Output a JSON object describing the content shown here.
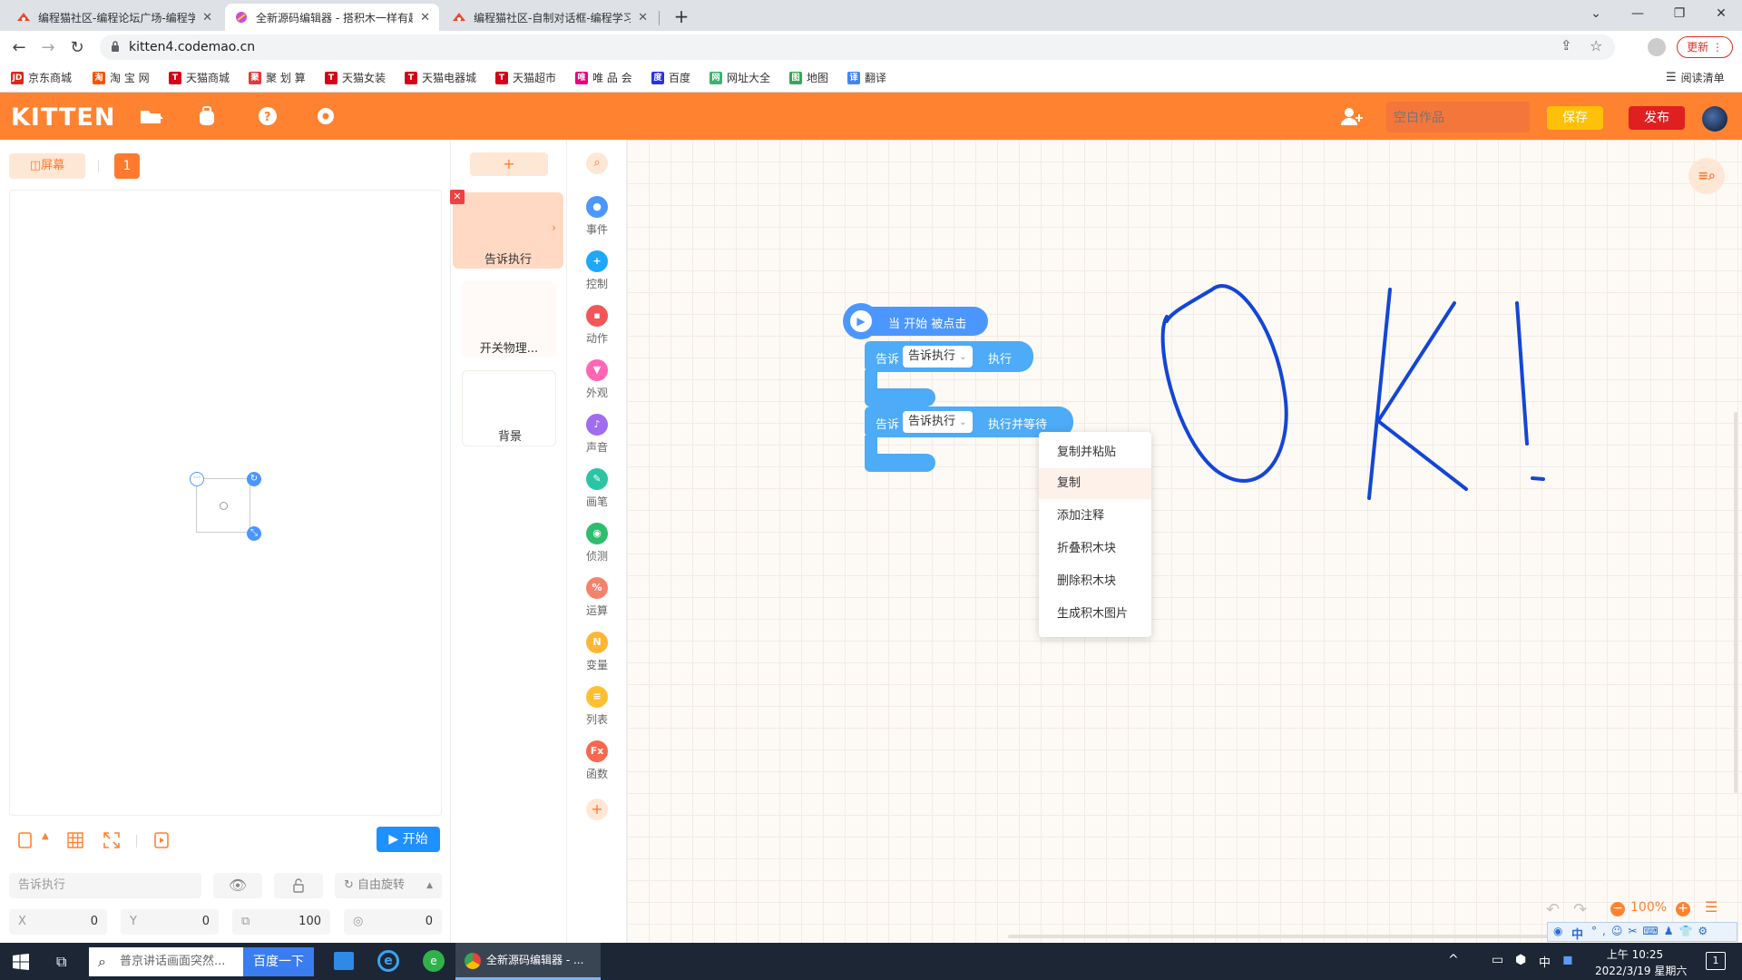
{
  "browser": {
    "tabs": [
      {
        "title": "编程猫社区-编程论坛广场-编程学"
      },
      {
        "title": "全新源码编辑器 - 搭积木一样有趣"
      },
      {
        "title": "编程猫社区-自制对话框-编程学习"
      }
    ],
    "new_tab": "+",
    "url": "kitten4.codemao.cn",
    "update_label": "更新",
    "bookmarks": [
      {
        "label": "京东商城",
        "badge": "JD",
        "color": "#e1251b"
      },
      {
        "label": "淘 宝 网",
        "badge": "淘",
        "color": "#ff5000"
      },
      {
        "label": "天猫商城",
        "badge": "T",
        "color": "#d4001a"
      },
      {
        "label": "聚 划 算",
        "badge": "聚",
        "color": "#e4393c"
      },
      {
        "label": "天猫女装",
        "badge": "T",
        "color": "#d4001a"
      },
      {
        "label": "天猫电器城",
        "badge": "T",
        "color": "#d4001a"
      },
      {
        "label": "天猫超市",
        "badge": "T",
        "color": "#d4001a"
      },
      {
        "label": "唯 品 会",
        "badge": "唯",
        "color": "#e6007e"
      },
      {
        "label": "百度",
        "badge": "度",
        "color": "#2932e1"
      },
      {
        "label": "网址大全",
        "badge": "网",
        "color": "#3cb371"
      },
      {
        "label": "地图",
        "badge": "图",
        "color": "#34a853"
      },
      {
        "label": "翻译",
        "badge": "译",
        "color": "#4285f4"
      }
    ],
    "reading_list": "阅读清单"
  },
  "app": {
    "logo": "KITTEN",
    "project_placeholder": "空白作品",
    "save_label": "保存",
    "publish_label": "发布",
    "accent": "#ff8230"
  },
  "stage": {
    "fullscreen_label": "屏幕",
    "page_number": "1",
    "start_label": "开始",
    "sprite_name": "告诉执行",
    "rotation_mode": "自由旋转",
    "x_label": "X",
    "x_value": "0",
    "y_label": "Y",
    "y_value": "0",
    "size_value": "100",
    "direction_value": "0"
  },
  "sprites": {
    "add_label": "+",
    "items": [
      {
        "name": "告诉执行"
      },
      {
        "name": "开关物理..."
      },
      {
        "name": "背景"
      }
    ]
  },
  "categories": [
    {
      "label": "事件",
      "icon": "event-icon",
      "color": "#4c97ff",
      "glyph": "●"
    },
    {
      "label": "控制",
      "icon": "control-icon",
      "color": "#1ea7fd",
      "glyph": "+"
    },
    {
      "label": "动作",
      "icon": "motion-icon",
      "color": "#f25656",
      "glyph": "▪"
    },
    {
      "label": "外观",
      "icon": "looks-icon",
      "color": "#ff66b3",
      "glyph": "▼"
    },
    {
      "label": "声音",
      "icon": "sound-icon",
      "color": "#a06cf0",
      "glyph": "♪"
    },
    {
      "label": "画笔",
      "icon": "pen-icon",
      "color": "#2bc5a6",
      "glyph": "✎"
    },
    {
      "label": "侦测",
      "icon": "sensing-icon",
      "color": "#2ebd6e",
      "glyph": "◉"
    },
    {
      "label": "运算",
      "icon": "operator-icon",
      "color": "#f5826b",
      "glyph": "%"
    },
    {
      "label": "变量",
      "icon": "variable-icon",
      "color": "#ffb636",
      "glyph": "N"
    },
    {
      "label": "列表",
      "icon": "list-icon",
      "color": "#ffbf33",
      "glyph": "≡"
    },
    {
      "label": "函数",
      "icon": "function-icon",
      "color": "#f7684e",
      "glyph": "Fx"
    }
  ],
  "blocks": {
    "hat": "当 开始 被点击",
    "tell1_prefix": "告诉",
    "tell1_target": "告诉执行",
    "tell1_suffix": "执行",
    "tell2_prefix": "告诉",
    "tell2_target": "告诉执行",
    "tell2_suffix": "执行并等待"
  },
  "context_menu": [
    "复制并粘贴",
    "复制",
    "添加注释",
    "折叠积木块",
    "删除积木块",
    "生成积木图片"
  ],
  "workspace": {
    "zoom": "100%"
  },
  "taskbar": {
    "search_placeholder": "普京讲话画面突然...",
    "search_button": "百度一下",
    "chrome_task": "全新源码编辑器 - ...",
    "ime": "中",
    "time": "上午 10:25",
    "date": "2022/3/19 星期六",
    "notifications": "1"
  }
}
